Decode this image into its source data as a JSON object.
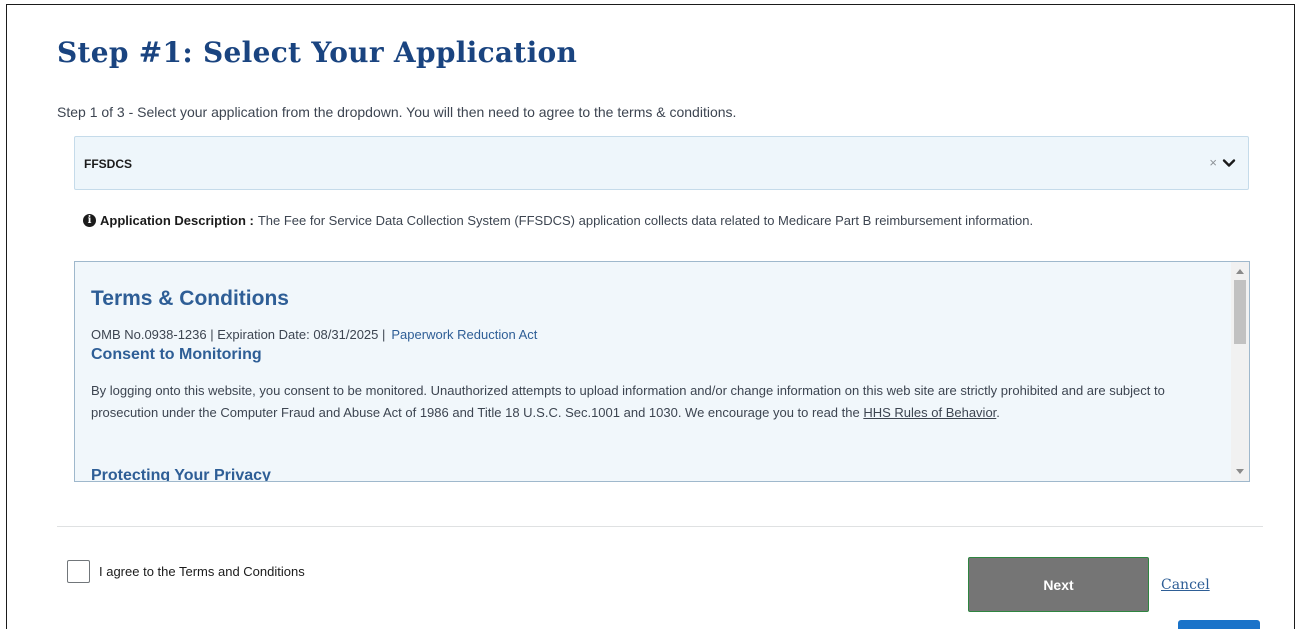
{
  "page": {
    "title": "Step #1: Select Your Application",
    "instructions": "Step 1 of 3 - Select your application from the dropdown. You will then need to agree to the terms & conditions."
  },
  "application_select": {
    "selected_value": "FFSDCS",
    "clear_glyph": "×",
    "icons": [
      "clear-icon",
      "chevron-down-icon"
    ]
  },
  "application_description": {
    "label": "Application Description :",
    "text": "The Fee for Service Data Collection System (FFSDCS) application collects data related to Medicare Part B reimbursement information."
  },
  "terms": {
    "title": "Terms & Conditions",
    "omb_text": "OMB No.0938-1236 | Expiration Date: 08/31/2025 |",
    "paperwork_link": "Paperwork Reduction Act",
    "consent_title": "Consent to Monitoring",
    "consent_text": "By logging onto this website, you consent to be monitored. Unauthorized attempts to upload information and/or change information on this web site are strictly prohibited and are subject to prosecution under the Computer Fraud and Abuse Act of 1986 and Title 18 U.S.C. Sec.1001 and 1030. We encourage you to read the ",
    "hhs_link": "HHS Rules of Behavior",
    "consent_end": ".",
    "privacy_title": "Protecting Your Privacy"
  },
  "footer": {
    "agree_label": "I agree to the Terms and Conditions",
    "agree_checked": false,
    "next_label": "Next",
    "cancel_label": "Cancel"
  },
  "colors": {
    "title": "#1a4480",
    "link": "#2e5e96",
    "select_bg": "#eef6fb",
    "terms_bg": "#f1f7fb",
    "next_bg": "#757575",
    "next_border": "#2e8540"
  }
}
